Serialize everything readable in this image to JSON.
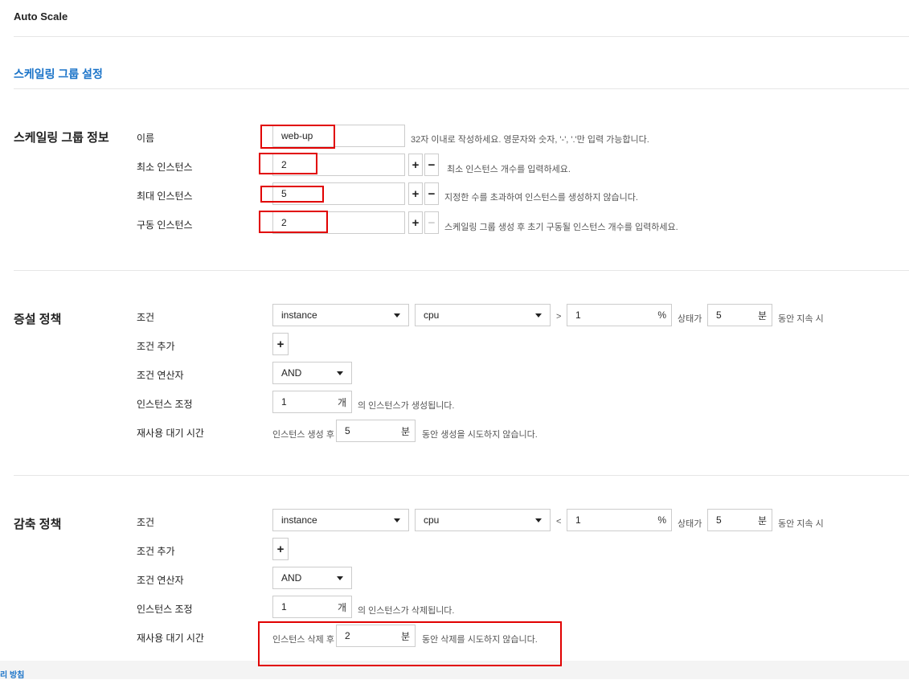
{
  "header": {
    "title": "Auto Scale"
  },
  "page": {
    "title": "스케일링 그룹 설정"
  },
  "group_info": {
    "section_title": "스케일링 그룹 정보",
    "name": {
      "label": "이름",
      "value": "web-up",
      "help": "32자 이내로 작성하세요. 영문자와 숫자, '-', '.'만 입력 가능합니다."
    },
    "min": {
      "label": "최소 인스턴스",
      "value": "2",
      "help": "최소 인스턴스 개수를 입력하세요."
    },
    "max": {
      "label": "최대 인스턴스",
      "value": "5",
      "help": "지정한 수를 초과하여 인스턴스를 생성하지 않습니다."
    },
    "run": {
      "label": "구동 인스턴스",
      "value": "2",
      "help": "스케일링 그룹 생성 후 초기 구동될 인스턴스 개수를 입력하세요."
    },
    "plus": "+",
    "minus": "−"
  },
  "scale_out": {
    "section_title": "증설 정책",
    "condition_label": "조건",
    "resource": "instance",
    "metric": "cpu",
    "operator": ">",
    "threshold": "1",
    "threshold_unit": "%",
    "state_text": "상태가",
    "duration": "5",
    "duration_unit": "분",
    "duration_suffix": "동안 지속 시",
    "add_condition_label": "조건 추가",
    "add_button": "+",
    "operator_label": "조건 연산자",
    "logic": "AND",
    "adjust_label": "인스턴스 조정",
    "adjust_value": "1",
    "adjust_unit": "개",
    "adjust_suffix": "의 인스턴스가 생성됩니다.",
    "cooldown_label": "재사용 대기 시간",
    "cooldown_prefix": "인스턴스 생성 후",
    "cooldown_value": "5",
    "cooldown_unit": "분",
    "cooldown_suffix": "동안 생성을 시도하지 않습니다."
  },
  "scale_in": {
    "section_title": "감축 정책",
    "condition_label": "조건",
    "resource": "instance",
    "metric": "cpu",
    "operator": "<",
    "threshold": "1",
    "threshold_unit": "%",
    "state_text": "상태가",
    "duration": "5",
    "duration_unit": "분",
    "duration_suffix": "동안 지속 시",
    "add_condition_label": "조건 추가",
    "add_button": "+",
    "operator_label": "조건 연산자",
    "logic": "AND",
    "adjust_label": "인스턴스 조정",
    "adjust_value": "1",
    "adjust_unit": "개",
    "adjust_suffix": "의 인스턴스가 삭제됩니다.",
    "cooldown_label": "재사용 대기 시간",
    "cooldown_prefix": "인스턴스 삭제 후",
    "cooldown_value": "2",
    "cooldown_unit": "분",
    "cooldown_suffix": "동안 삭제를 시도하지 않습니다."
  },
  "footer": {
    "link": "리 방침"
  },
  "colors": {
    "accent": "#1a73c8",
    "highlight": "#e10000",
    "footer_bg": "#f4f4f4"
  }
}
